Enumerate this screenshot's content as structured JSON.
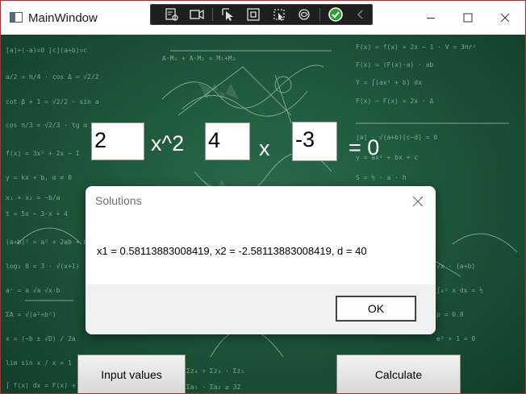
{
  "window": {
    "title": "MainWindow"
  },
  "equation": {
    "a": "2",
    "x2_label": "x^2",
    "b": "4",
    "x_label": "x",
    "c": "-3",
    "equals_label": "= 0"
  },
  "buttons": {
    "input_values": "Input values",
    "calculate": "Calculate"
  },
  "dialog": {
    "title": "Solutions",
    "message": "x1 = 0.58113883008419, x2 = -2.58113883008419, d = 40",
    "ok": "OK"
  },
  "debug_toolbar": {
    "icons": [
      "live-visual-tree-icon",
      "record-icon",
      "select-element-icon",
      "display-layout-adorners-icon",
      "track-focus-icon",
      "binding-failures-icon",
      "hot-reload-status-icon",
      "collapse-toolbar-icon"
    ],
    "status_color": "#2fa12f"
  },
  "colors": {
    "chalkboard": "#1f5a3d",
    "window_border": "#d02020"
  }
}
